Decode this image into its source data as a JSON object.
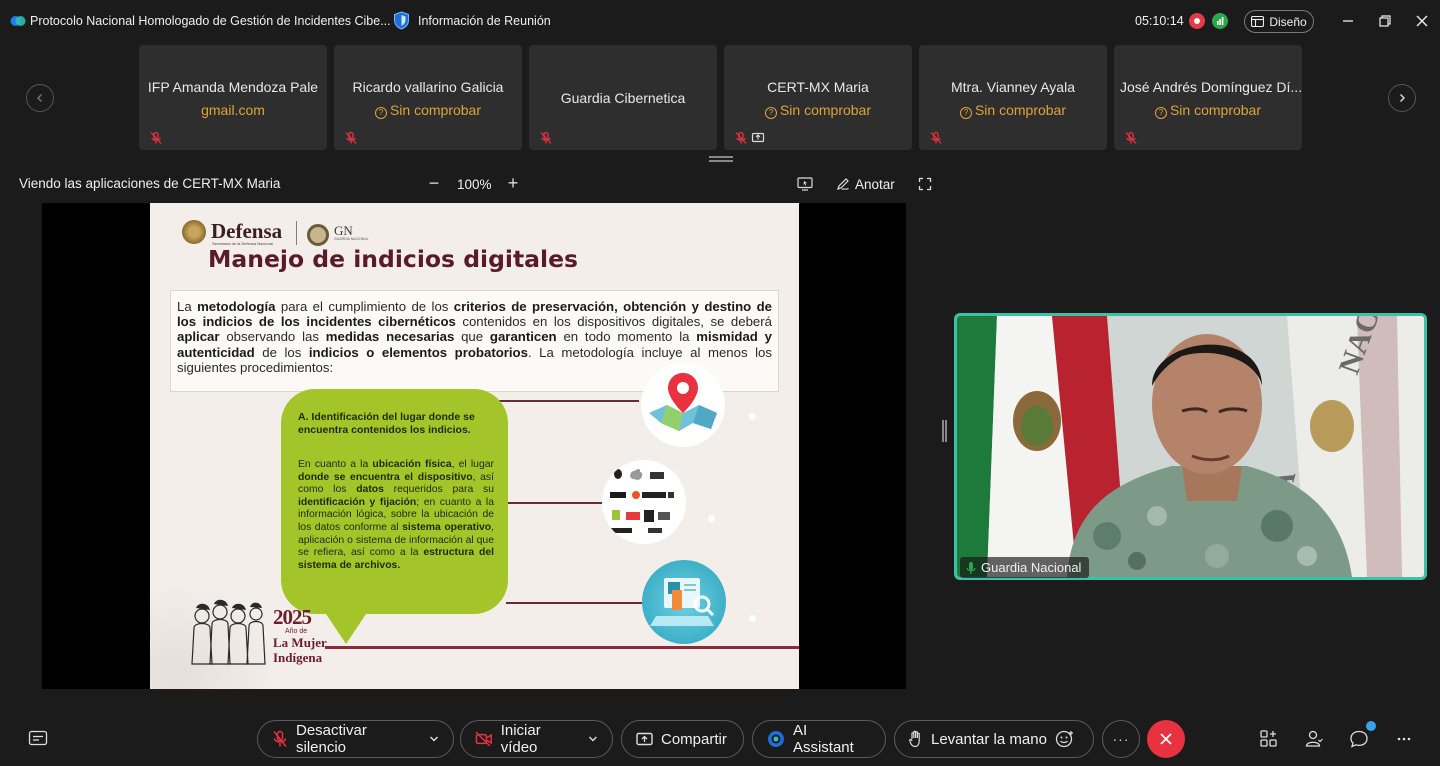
{
  "window": {
    "title": "Protocolo Nacional Homologado de Gestión de Incidentes Cibe...",
    "meeting_info": "Información de Reunión",
    "timer": "05:10:14",
    "layout_label": "Diseño"
  },
  "participants": [
    {
      "name": "IFP Amanda Mendoza Pale",
      "sub": "gmail.com",
      "status": "email",
      "muted": true
    },
    {
      "name": "Ricardo vallarino Galicia",
      "sub": "Sin comprobar",
      "status": "unverified",
      "muted": true
    },
    {
      "name": "Guardia Cibernetica",
      "sub": "",
      "status": "none",
      "muted": true
    },
    {
      "name": "CERT-MX Maria",
      "sub": "Sin comprobar",
      "status": "unverified",
      "muted": true,
      "sharing": true
    },
    {
      "name": "Mtra. Vianney Ayala",
      "sub": "Sin comprobar",
      "status": "unverified",
      "muted": true
    },
    {
      "name": "José Andrés Domínguez Dí...",
      "sub": "Sin comprobar",
      "status": "unverified",
      "muted": true
    }
  ],
  "share_bar": {
    "label": "Viendo las aplicaciones de CERT-MX Maria",
    "zoom_minus": "−",
    "zoom": "100%",
    "zoom_plus": "+",
    "annotate": "Anotar"
  },
  "slide": {
    "brand": "Defensa",
    "brand_sub": "Secretaría de la Defensa Nacional",
    "gn": "GN",
    "gn_sub": "GUARDIA NACIONAL",
    "title": "Manejo de indicios digitales",
    "intro_parts": [
      {
        "t": "La ",
        "b": false
      },
      {
        "t": "metodología",
        "b": true
      },
      {
        "t": " para el cumplimiento de los ",
        "b": false
      },
      {
        "t": "criterios de preservación, obtención y destino de los indicios de los incidentes cibernéticos",
        "b": true
      },
      {
        "t": " contenidos en los dispositivos digitales, se deberá ",
        "b": false
      },
      {
        "t": "aplicar",
        "b": true
      },
      {
        "t": " observando las ",
        "b": false
      },
      {
        "t": "medidas necesarias",
        "b": true
      },
      {
        "t": " que ",
        "b": false
      },
      {
        "t": "garanticen",
        "b": true
      },
      {
        "t": " en todo momento la ",
        "b": false
      },
      {
        "t": "mismidad y autenticidad",
        "b": true
      },
      {
        "t": " de los ",
        "b": false
      },
      {
        "t": "indicios o elementos probatorios",
        "b": true
      },
      {
        "t": ". La metodología incluye al menos los siguientes procedimientos:",
        "b": false
      }
    ],
    "bubble_heading": "A. Identificación del lugar donde se encuentra contenidos los indicios.",
    "bubble_parts": [
      {
        "t": "En cuanto a la ",
        "b": false
      },
      {
        "t": "ubicación física",
        "b": true
      },
      {
        "t": ", el lugar ",
        "b": false
      },
      {
        "t": "donde se encuentra el dispositivo",
        "b": true
      },
      {
        "t": ", así como los ",
        "b": false
      },
      {
        "t": "datos",
        "b": true
      },
      {
        "t": " requeridos para su ",
        "b": false
      },
      {
        "t": "identificación y fijación",
        "b": true
      },
      {
        "t": "; en cuanto a la información lógica, sobre la ubicación de los datos conforme al ",
        "b": false
      },
      {
        "t": "sistema operativo",
        "b": true
      },
      {
        "t": ", aplicación o sistema de información al que se refiera, así como a la ",
        "b": false
      },
      {
        "t": "estructura del sistema de archivos.",
        "b": true
      }
    ],
    "year": "2025",
    "year_sub": "Año de",
    "year_mujer": "La Mujer",
    "year_indigena": "Indígena"
  },
  "camera": {
    "label": "Guardia Nacional"
  },
  "toolbar": {
    "unmute": "Desactivar silencio",
    "start_video": "Iniciar vídeo",
    "share": "Compartir",
    "ai": "AI Assistant",
    "raise_hand": "Levantar la mano",
    "more": "···"
  },
  "colors": {
    "accent_teal": "#3cc0a8",
    "hangup_red": "#e8323f",
    "mic_muted_red": "#e8323f",
    "unverified_amber": "#e0a33a",
    "slide_title": "#5a1a2a",
    "bubble_green": "#a4c52a"
  }
}
